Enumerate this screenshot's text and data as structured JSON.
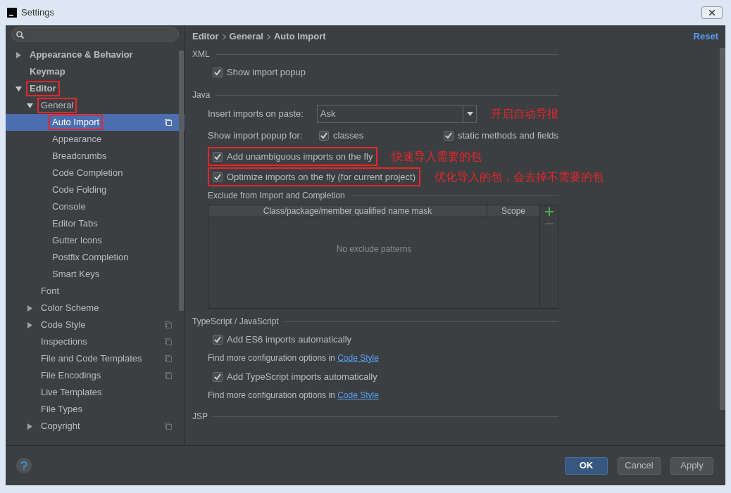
{
  "window": {
    "title": "Settings"
  },
  "sidebar": {
    "items": [
      {
        "label": "Appearance & Behavior",
        "expanded": false,
        "selected": false,
        "annotated": false,
        "project_icon": false
      },
      {
        "label": "Keymap",
        "selected": false,
        "annotated": false,
        "project_icon": false
      },
      {
        "label": "Editor",
        "expanded": true,
        "selected": false,
        "annotated": true,
        "project_icon": false,
        "children": [
          {
            "label": "General",
            "expanded": true,
            "selected": false,
            "annotated": true,
            "project_icon": false,
            "children": [
              {
                "label": "Auto Import",
                "selected": true,
                "annotated": true,
                "project_icon": true
              },
              {
                "label": "Appearance",
                "selected": false,
                "annotated": false,
                "project_icon": false
              },
              {
                "label": "Breadcrumbs",
                "selected": false,
                "annotated": false,
                "project_icon": false
              },
              {
                "label": "Code Completion",
                "selected": false,
                "annotated": false,
                "project_icon": false
              },
              {
                "label": "Code Folding",
                "selected": false,
                "annotated": false,
                "project_icon": false
              },
              {
                "label": "Console",
                "selected": false,
                "annotated": false,
                "project_icon": false
              },
              {
                "label": "Editor Tabs",
                "selected": false,
                "annotated": false,
                "project_icon": false
              },
              {
                "label": "Gutter Icons",
                "selected": false,
                "annotated": false,
                "project_icon": false
              },
              {
                "label": "Postfix Completion",
                "selected": false,
                "annotated": false,
                "project_icon": false
              },
              {
                "label": "Smart Keys",
                "selected": false,
                "annotated": false,
                "project_icon": false
              }
            ]
          },
          {
            "label": "Font",
            "selected": false,
            "annotated": false,
            "project_icon": false
          },
          {
            "label": "Color Scheme",
            "expanded": false,
            "selected": false,
            "annotated": false,
            "project_icon": false
          },
          {
            "label": "Code Style",
            "expanded": false,
            "selected": false,
            "annotated": false,
            "project_icon": true
          },
          {
            "label": "Inspections",
            "selected": false,
            "annotated": false,
            "project_icon": true
          },
          {
            "label": "File and Code Templates",
            "selected": false,
            "annotated": false,
            "project_icon": true
          },
          {
            "label": "File Encodings",
            "selected": false,
            "annotated": false,
            "project_icon": true
          },
          {
            "label": "Live Templates",
            "selected": false,
            "annotated": false,
            "project_icon": false
          },
          {
            "label": "File Types",
            "selected": false,
            "annotated": false,
            "project_icon": false
          },
          {
            "label": "Copyright",
            "expanded": false,
            "selected": false,
            "annotated": false,
            "project_icon": true
          }
        ]
      }
    ]
  },
  "breadcrumb": [
    "Editor",
    "General",
    "Auto Import"
  ],
  "reset": "Reset",
  "sections": [
    {
      "title": "XML",
      "rows": [
        {
          "kind": "checkbox",
          "label": "Show import popup",
          "checked": true,
          "annotated": false
        }
      ]
    },
    {
      "title": "Java",
      "rows": [
        {
          "kind": "select",
          "label": "Insert imports on paste:",
          "value": "Ask",
          "note": "开启自动导报"
        },
        {
          "kind": "checkbox_pair",
          "label": "Show import popup for:",
          "options": [
            {
              "label": "classes",
              "checked": true
            },
            {
              "label": "static methods and fields",
              "checked": true
            }
          ]
        },
        {
          "kind": "checkbox",
          "label": "Add unambiguous imports on the fly",
          "checked": true,
          "annotated": true,
          "note": "快速导入需要的包"
        },
        {
          "kind": "checkbox",
          "label": "Optimize imports on the fly (for current project)",
          "checked": true,
          "annotated": true,
          "note": "优化导入的包，会去掉不需要的包"
        },
        {
          "kind": "table",
          "title": "Exclude from Import and Completion",
          "columns": [
            "Class/package/member qualified name mask",
            "Scope"
          ],
          "empty_text": "No exclude patterns"
        }
      ]
    },
    {
      "title": "TypeScript / JavaScript",
      "rows": [
        {
          "kind": "checkbox",
          "label": "Add ES6 imports automatically",
          "checked": true,
          "annotated": false
        },
        {
          "kind": "hint",
          "text": "Find more configuration options in",
          "link": "Code Style"
        },
        {
          "kind": "checkbox",
          "label": "Add TypeScript imports automatically",
          "checked": true,
          "annotated": false
        },
        {
          "kind": "hint",
          "text": "Find more configuration options in",
          "link": "Code Style"
        }
      ]
    },
    {
      "title": "JSP"
    }
  ],
  "buttons": [
    {
      "label": "OK",
      "primary": true
    },
    {
      "label": "Cancel",
      "primary": false
    },
    {
      "label": "Apply",
      "primary": false
    }
  ]
}
